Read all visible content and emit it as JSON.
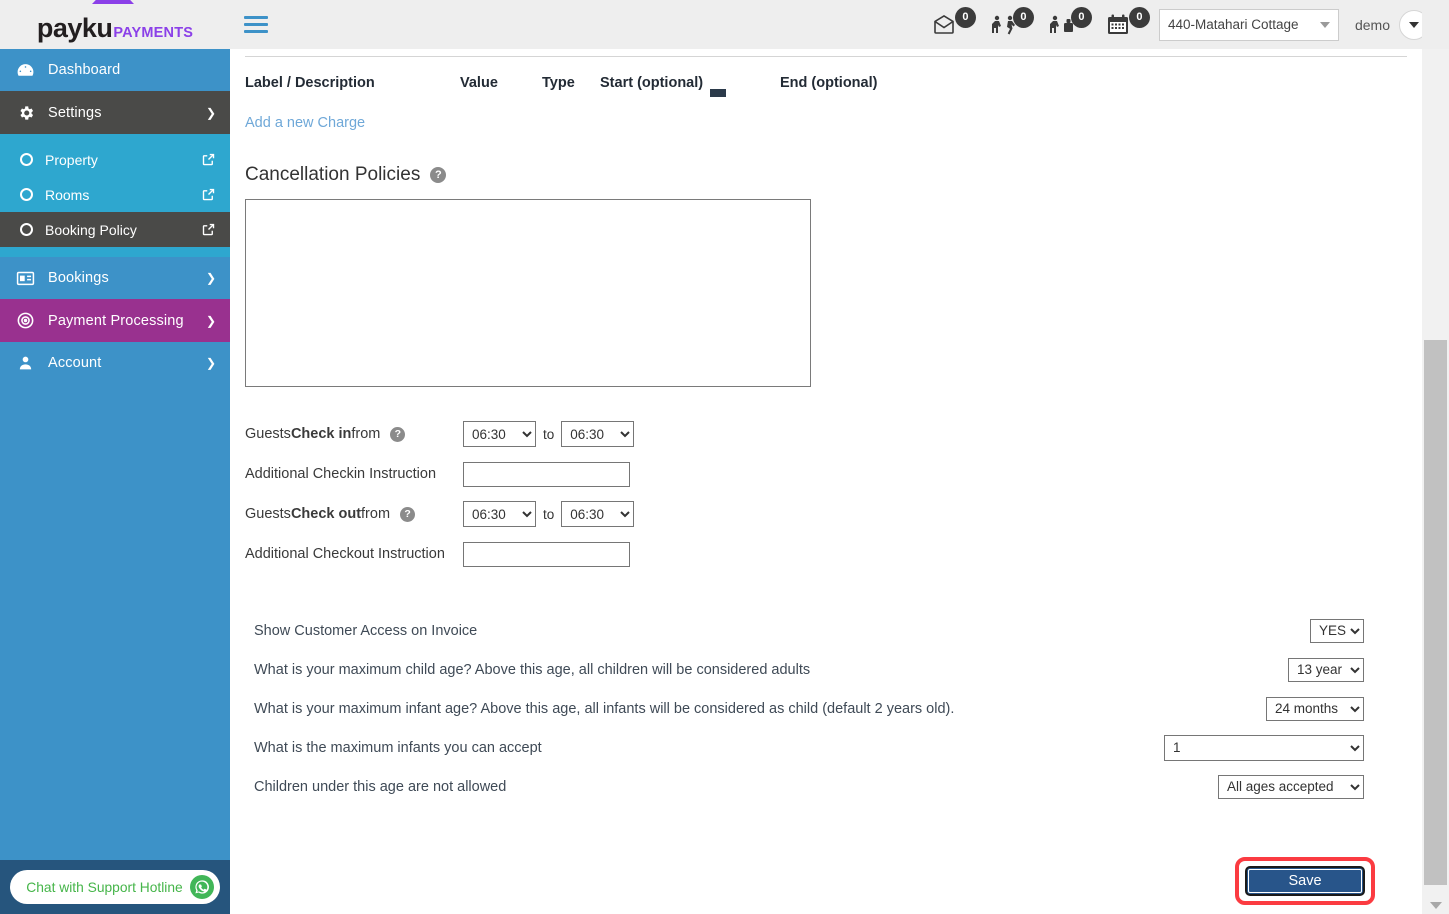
{
  "brand": {
    "name": "payku",
    "suffix": "PAYMENTS",
    "accent": "#8b40e8"
  },
  "topbar": {
    "menu_icon": "hamburger-icon",
    "counters": [
      {
        "icon": "envelope-icon",
        "count": "0"
      },
      {
        "icon": "checkin-guest-icon",
        "count": "0"
      },
      {
        "icon": "checkout-guest-icon",
        "count": "0"
      },
      {
        "icon": "calendar-icon",
        "count": "0"
      }
    ],
    "property_selected": "440-Matahari Cottage",
    "user_name": "demo"
  },
  "sidebar": {
    "items": [
      {
        "label": "Dashboard",
        "icon": "dashboard-icon",
        "state": "normal"
      },
      {
        "label": "Settings",
        "icon": "gear-icon",
        "state": "expanded"
      },
      {
        "label": "Bookings",
        "icon": "bookings-icon",
        "state": "normal"
      },
      {
        "label": "Payment Processing",
        "icon": "target-icon",
        "state": "highlight"
      },
      {
        "label": "Account",
        "icon": "user-icon",
        "state": "normal"
      }
    ],
    "submenu": [
      {
        "label": "Property",
        "active": false
      },
      {
        "label": "Rooms",
        "active": false
      },
      {
        "label": "Booking Policy",
        "active": true
      }
    ]
  },
  "main": {
    "charges_table": {
      "columns": [
        "Label / Description",
        "Value",
        "Type",
        "Start (optional)",
        "End (optional)"
      ]
    },
    "add_charge_link": "Add a new Charge",
    "cancellation": {
      "title": "Cancellation Policies",
      "help": "?",
      "value": "",
      "placeholder": ""
    },
    "checkin": {
      "label_prefix": "Guests ",
      "label_bold": "Check in",
      "label_suffix": " from",
      "from": "06:30",
      "to_word": "to",
      "to": "06:30",
      "instruction_label": "Additional Checkin Instruction",
      "instruction_value": ""
    },
    "checkout": {
      "label_prefix": "Guests ",
      "label_bold": "Check out",
      "label_suffix": " from",
      "from": "06:30",
      "to_word": "to",
      "to": "06:30",
      "instruction_label": "Additional Checkout Instruction",
      "instruction_value": ""
    },
    "options": [
      {
        "label": "Show Customer Access on Invoice",
        "value": "YES"
      },
      {
        "label": "What is your maximum child age? Above this age, all children will be considered adults",
        "value": "13 year"
      },
      {
        "label": "What is your maximum infant age? Above this age, all infants will be considered as child (default 2 years old).",
        "value": "24 months"
      },
      {
        "label": "What is the maximum infants you can accept",
        "value": "1"
      },
      {
        "label": "Children under this age are not allowed",
        "value": "All ages accepted"
      }
    ],
    "save_label": "Save",
    "save_highlight_color": "#fb3b41"
  },
  "chat": {
    "label": "Chat with Support Hotline",
    "icon": "whatsapp-icon",
    "color": "#45b549"
  }
}
